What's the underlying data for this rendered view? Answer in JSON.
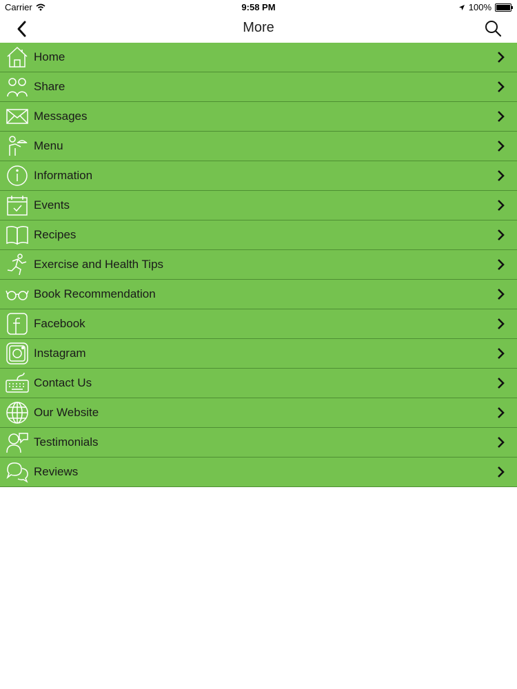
{
  "status_bar": {
    "carrier": "Carrier",
    "time": "9:58 PM",
    "battery": "100%"
  },
  "nav": {
    "title": "More",
    "back_icon": "chevron-left-icon",
    "search_icon": "search-icon"
  },
  "colors": {
    "menu_bg": "#75c24f",
    "divider": "#4e8f33"
  },
  "menu": {
    "items": [
      {
        "label": "Home",
        "icon": "home-icon"
      },
      {
        "label": "Share",
        "icon": "share-icon"
      },
      {
        "label": "Messages",
        "icon": "envelope-icon"
      },
      {
        "label": "Menu",
        "icon": "waiter-icon"
      },
      {
        "label": "Information",
        "icon": "info-icon"
      },
      {
        "label": "Events",
        "icon": "calendar-icon"
      },
      {
        "label": "Recipes",
        "icon": "book-icon"
      },
      {
        "label": "Exercise and Health Tips",
        "icon": "running-icon"
      },
      {
        "label": "Book Recommendation",
        "icon": "glasses-icon"
      },
      {
        "label": "Facebook",
        "icon": "facebook-icon"
      },
      {
        "label": "Instagram",
        "icon": "instagram-icon"
      },
      {
        "label": "Contact Us",
        "icon": "keyboard-icon"
      },
      {
        "label": "Our Website",
        "icon": "globe-icon"
      },
      {
        "label": "Testimonials",
        "icon": "testimonial-icon"
      },
      {
        "label": "Reviews",
        "icon": "chat-bubbles-icon"
      }
    ]
  }
}
